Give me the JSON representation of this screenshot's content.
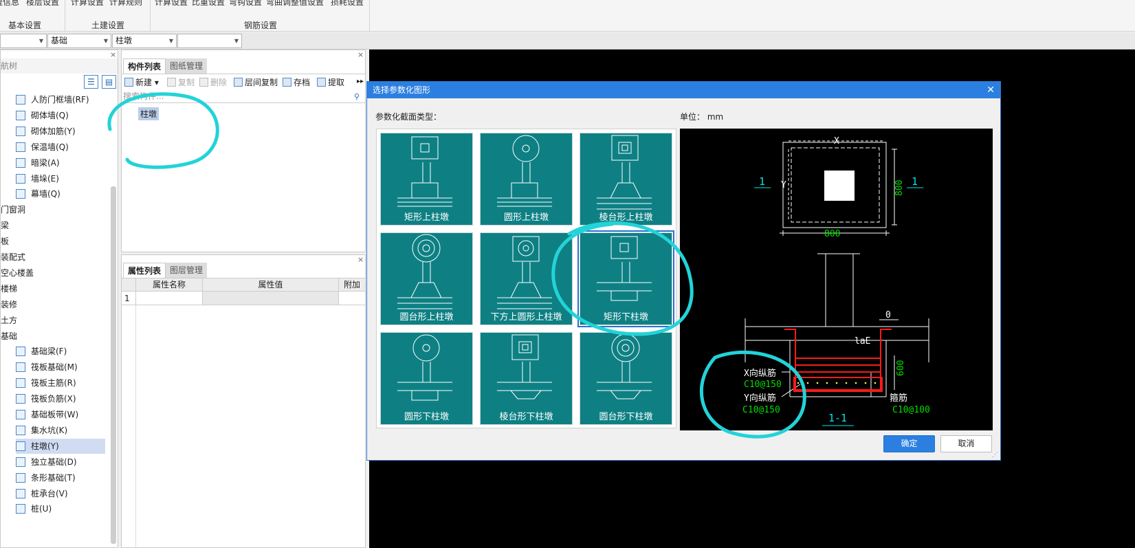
{
  "ribbon": {
    "top_items": [
      "程信息",
      "楼层设置",
      "计算设置",
      "计算规则",
      "计算设置",
      "比重设置",
      "弯钩设置",
      "弯曲调整值设置",
      "损耗设置"
    ],
    "groups": [
      {
        "label": "基本设置"
      },
      {
        "label": "土建设置"
      },
      {
        "label": "钢筋设置"
      }
    ]
  },
  "combos": [
    "",
    "基础",
    "柱墩",
    ""
  ],
  "tree": {
    "header": "航树",
    "items": [
      {
        "label": "人防门框墙(RF)",
        "icon": "wall-door-icon",
        "level": 2
      },
      {
        "label": "砌体墙(Q)",
        "icon": "masonry-wall-icon",
        "level": 2
      },
      {
        "label": "砌体加筋(Y)",
        "icon": "masonry-rebar-icon",
        "level": 2
      },
      {
        "label": "保温墙(Q)",
        "icon": "insulation-wall-icon",
        "level": 2
      },
      {
        "label": "暗梁(A)",
        "icon": "hidden-beam-icon",
        "level": 2
      },
      {
        "label": "墙垛(E)",
        "icon": "wall-pier-icon",
        "level": 2
      },
      {
        "label": "幕墙(Q)",
        "icon": "curtain-wall-icon",
        "level": 2
      },
      {
        "label": "门窗洞",
        "icon": "",
        "level": 1
      },
      {
        "label": "梁",
        "icon": "",
        "level": 1
      },
      {
        "label": "板",
        "icon": "",
        "level": 1
      },
      {
        "label": "装配式",
        "icon": "",
        "level": 1
      },
      {
        "label": "空心楼盖",
        "icon": "",
        "level": 1
      },
      {
        "label": "楼梯",
        "icon": "",
        "level": 1
      },
      {
        "label": "装修",
        "icon": "",
        "level": 1
      },
      {
        "label": "土方",
        "icon": "",
        "level": 1
      },
      {
        "label": "基础",
        "icon": "",
        "level": 1
      },
      {
        "label": "基础梁(F)",
        "icon": "foundation-beam-icon",
        "level": 2
      },
      {
        "label": "筏板基础(M)",
        "icon": "raft-foundation-icon",
        "level": 2
      },
      {
        "label": "筏板主筋(R)",
        "icon": "raft-main-rebar-icon",
        "level": 2
      },
      {
        "label": "筏板负筋(X)",
        "icon": "raft-neg-rebar-icon",
        "level": 2
      },
      {
        "label": "基础板带(W)",
        "icon": "foundation-strip-icon",
        "level": 2
      },
      {
        "label": "集水坑(K)",
        "icon": "sump-icon",
        "level": 2
      },
      {
        "label": "柱墩(Y)",
        "icon": "column-pier-icon",
        "level": 2,
        "selected": true
      },
      {
        "label": "独立基础(D)",
        "icon": "isolated-foundation-icon",
        "level": 2
      },
      {
        "label": "条形基础(T)",
        "icon": "strip-foundation-icon",
        "level": 2
      },
      {
        "label": "桩承台(V)",
        "icon": "pile-cap-icon",
        "level": 2
      },
      {
        "label": "桩(U)",
        "icon": "pile-icon",
        "level": 2
      }
    ]
  },
  "component_list": {
    "tabs": [
      "构件列表",
      "图纸管理"
    ],
    "toolbar": [
      {
        "label": "新建",
        "icon": "new-icon",
        "enabled": true
      },
      {
        "label": "复制",
        "icon": "copy-icon",
        "enabled": false
      },
      {
        "label": "删除",
        "icon": "delete-icon",
        "enabled": false
      },
      {
        "label": "层间复制",
        "icon": "floor-copy-icon",
        "enabled": true
      },
      {
        "label": "存档",
        "icon": "archive-icon",
        "enabled": true
      },
      {
        "label": "提取",
        "icon": "extract-icon",
        "enabled": true
      }
    ],
    "search_placeholder": "搜索构件...",
    "items": [
      "柱墩"
    ]
  },
  "properties": {
    "tabs": [
      "属性列表",
      "图层管理"
    ],
    "columns": [
      "属性名称",
      "属性值",
      "附加"
    ],
    "rows": [
      {
        "num": "1",
        "name": "",
        "value": "",
        "extra": ""
      }
    ]
  },
  "dialog": {
    "title": "选择参数化图形",
    "section_label": "参数化截面类型：",
    "unit_label": "单位：",
    "unit_value": "mm",
    "shapes": [
      {
        "label": "矩形上柱墩",
        "top": "square",
        "bottom": "rect"
      },
      {
        "label": "圆形上柱墩",
        "top": "circle",
        "bottom": "rect"
      },
      {
        "label": "棱台形上柱墩",
        "top": "frustum",
        "bottom": "trap"
      },
      {
        "label": "圆台形上柱墩",
        "top": "ring",
        "bottom": "trap"
      },
      {
        "label": "下方上圆形上柱墩",
        "top": "square-circle",
        "bottom": "trap"
      },
      {
        "label": "矩形下柱墩",
        "top": "square",
        "bottom": "rect-down",
        "selected": true
      },
      {
        "label": "圆形下柱墩",
        "top": "circle",
        "bottom": "rect-down"
      },
      {
        "label": "棱台形下柱墩",
        "top": "frustum",
        "bottom": "trap-down"
      },
      {
        "label": "圆台形下柱墩",
        "top": "ring",
        "bottom": "trap-down"
      }
    ],
    "preview": {
      "dim_x": "X",
      "dim_y": "Y",
      "dim_800_h": "800",
      "dim_800_v": "800",
      "section_marker": "1",
      "dim_0": "0",
      "dim_lae": "laE",
      "dim_600": "600",
      "x_rebar_label": "X向纵筋",
      "x_rebar_value": "C10@150",
      "y_rebar_label": "Y向纵筋",
      "y_rebar_value": "C10@150",
      "stirrup_label": "箍筋",
      "stirrup_value": "C10@100",
      "section_title": "1-1"
    },
    "ok_label": "确定",
    "cancel_label": "取消"
  },
  "colors": {
    "tile": "#0e8084",
    "title_bar": "#2b7fe0",
    "annotation": "#22d3d8",
    "cad_green": "#00dd00",
    "cad_cyan": "#00e5e5",
    "rebar_red": "#ff1a1a"
  }
}
